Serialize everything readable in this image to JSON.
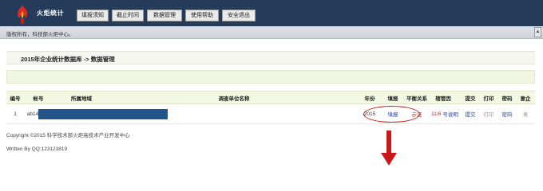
{
  "header": {
    "app_title": "火炬统计",
    "nav": [
      "填报须知",
      "截止时间",
      "数据管理",
      "使用帮助",
      "安全退出"
    ]
  },
  "infobar": {
    "text": "版权所有，科技部火炬中心。",
    "scroll_glyph": "▲"
  },
  "section": {
    "title": "2015年企业统计数据库 -> 数据管理"
  },
  "table": {
    "columns": [
      "编号",
      "帐号",
      "所属地域",
      "调查单位名称",
      "年份",
      "填报",
      "平衡关系",
      "辖管因",
      "提交",
      "打印",
      "密码",
      "意企"
    ],
    "rows": [
      {
        "id": "1",
        "account": "ab14",
        "region": "",
        "unit_name": "",
        "year": "2015",
        "fill": "填报",
        "balance": "示证",
        "jurisdiction": "11/6",
        "jurisdiction_link": "号说明",
        "submit": "提交",
        "print": "打印",
        "password": "密码",
        "other": "意"
      }
    ]
  },
  "footer": {
    "copyright": "Copyright ©2015 科学技术部火炬高技术产业开发中心",
    "written_by": "Written By QQ:123123819"
  },
  "colors": {
    "topbar": "#243b5a",
    "annotation_red": "#c81818",
    "redaction_blue": "#23558c",
    "table_header_bg": "#f3f8e2",
    "link_blue": "#2a3fa8"
  }
}
